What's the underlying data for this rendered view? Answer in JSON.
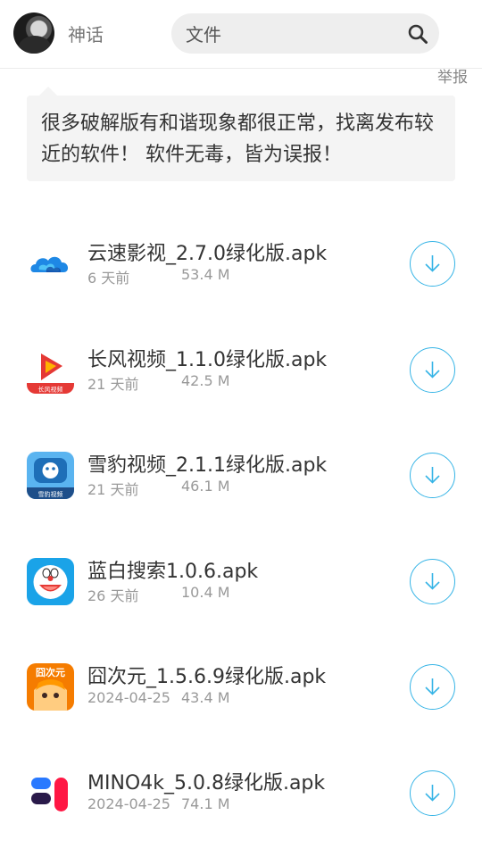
{
  "header": {
    "username": "神话",
    "search": {
      "value": "文件",
      "placeholder": "文件"
    }
  },
  "report_label": "举报",
  "notice": "很多破解版有和谐现象都很正常，找离发布较近的软件！ 软件无毒，皆为误报！",
  "accent_color": "#36b4e6",
  "files": [
    {
      "name": "云速影视_2.7.0绿化版.apk",
      "date": "6 天前",
      "size": "53.4 M",
      "icon": "cloud-app-icon"
    },
    {
      "name": "长风视频_1.1.0绿化版.apk",
      "date": "21 天前",
      "size": "42.5 M",
      "icon": "play-app-icon",
      "icon_text": "长风视频"
    },
    {
      "name": "雪豹视频_2.1.1绿化版.apk",
      "date": "21 天前",
      "size": "46.1 M",
      "icon": "tv-app-icon",
      "icon_text": "雪豹视频"
    },
    {
      "name": "蓝白搜索1.0.6.apk",
      "date": "26 天前",
      "size": "10.4 M",
      "icon": "doraemon-app-icon"
    },
    {
      "name": "囧次元_1.5.6.9绿化版.apk",
      "date": "2024-04-25",
      "size": "43.4 M",
      "icon": "anime-app-icon",
      "icon_text": "囧次元"
    },
    {
      "name": "MINO4k_5.0.8绿化版.apk",
      "date": "2024-04-25",
      "size": "74.1 M",
      "icon": "mino-app-icon"
    }
  ]
}
